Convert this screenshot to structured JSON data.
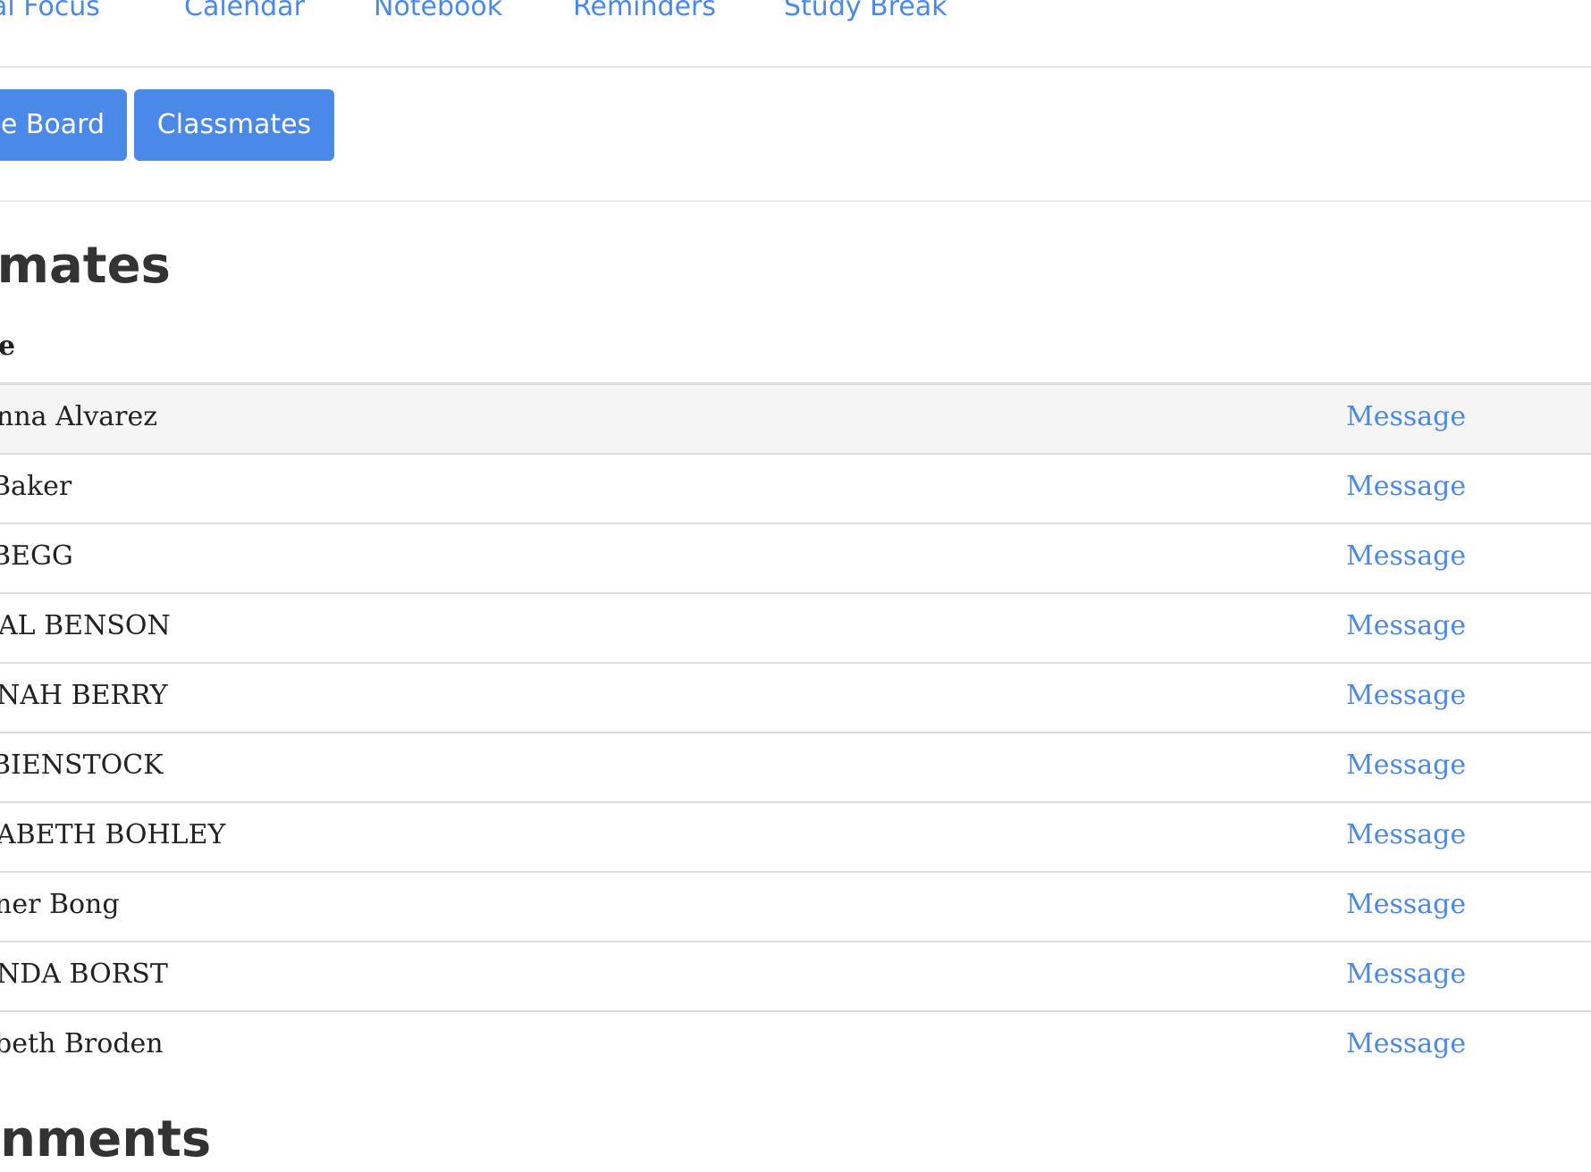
{
  "topnav": {
    "items": [
      {
        "label": "al Focus"
      },
      {
        "label": "Calendar"
      },
      {
        "label": "Notebook"
      },
      {
        "label": "Reminders"
      },
      {
        "label": "Study Break"
      }
    ]
  },
  "subnav": {
    "notice_board_label": "e Board",
    "classmates_label": "Classmates"
  },
  "main": {
    "title": "ssmates",
    "column_header": "e",
    "rows": [
      {
        "name": "nna Alvarez",
        "action": "Message"
      },
      {
        "name": " Baker",
        "action": "Message"
      },
      {
        "name": " BEGG",
        "action": "Message"
      },
      {
        "name": "AL BENSON",
        "action": "Message"
      },
      {
        "name": "NAH BERRY",
        "action": "Message"
      },
      {
        "name": " BIENSTOCK",
        "action": "Message"
      },
      {
        "name": "ABETH BOHLEY",
        "action": "Message"
      },
      {
        "name": "ner Bong",
        "action": "Message"
      },
      {
        "name": "NDA BORST",
        "action": "Message"
      },
      {
        "name": "beth Broden",
        "action": "Message"
      }
    ],
    "next_heading": "gnments"
  },
  "colors": {
    "accent": "#4a89e8",
    "row_highlight": "#f5f5f5",
    "border": "#dddddd",
    "text": "#222222"
  }
}
